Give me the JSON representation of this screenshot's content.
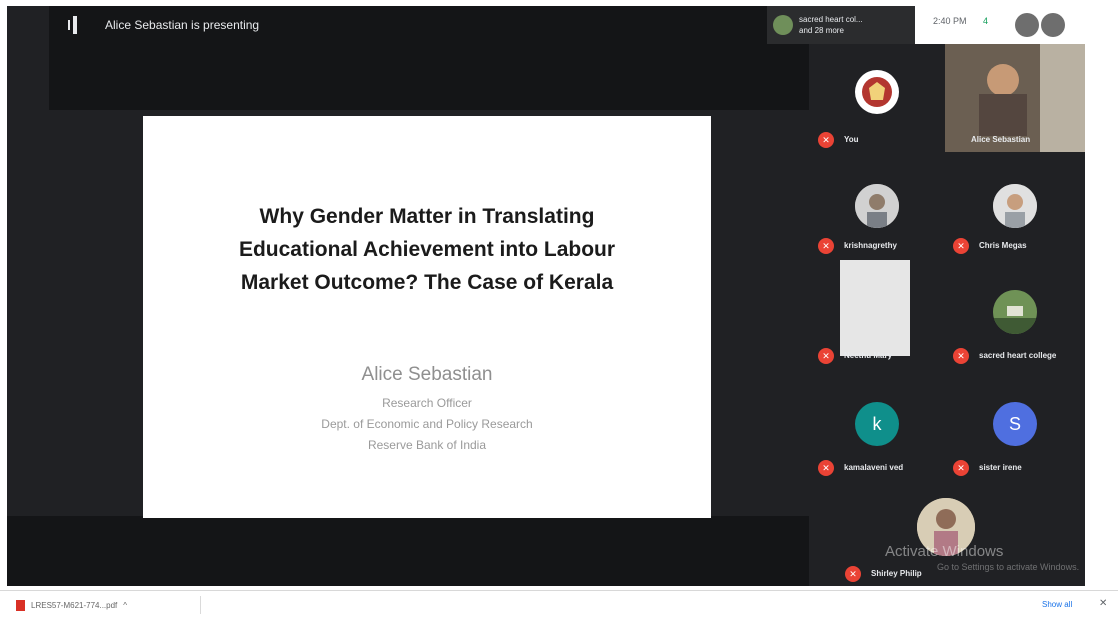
{
  "presenting_banner": {
    "text": "Alice Sebastian is presenting"
  },
  "host_chip": {
    "text_line1": "sacred heart col...",
    "text_line2": "and 28 more"
  },
  "controls": {
    "time_label": "2:40 PM",
    "chat_count": "4"
  },
  "slide": {
    "title_lines": [
      "Why Gender Matter in Translating",
      "Educational Achievement into Labour",
      "Market Outcome? The Case of Kerala"
    ],
    "author": "Alice Sebastian",
    "lines": [
      "Research Officer",
      "Dept. of Economic and Policy Research",
      "Reserve Bank of India"
    ]
  },
  "participants": [
    {
      "name": "You",
      "avatar_letter": "",
      "color": "#ffffff"
    },
    {
      "name": "Alice Sebastian",
      "avatar_letter": "",
      "color": "#6b5f52"
    },
    {
      "name": "krishnagrethy",
      "avatar_letter": "",
      "color": "#c9c9c9"
    },
    {
      "name": "Chris Megas",
      "avatar_letter": "",
      "color": "#c9c9c9"
    },
    {
      "name": "Neethu Mary",
      "avatar_letter": "",
      "color": "#e6e6e6"
    },
    {
      "name": "sacred heart college",
      "avatar_letter": "",
      "color": "#3f5a34"
    },
    {
      "name": "kamalaveni ved",
      "avatar_letter": "k",
      "color": "#0f8f8b"
    },
    {
      "name": "sister irene",
      "avatar_letter": "S",
      "color": "#4f6fe0"
    },
    {
      "name": "Shirley Philip",
      "avatar_letter": "",
      "color": "#d9cbb0"
    }
  ],
  "watermark": {
    "line1": "Activate Windows",
    "line2": "Go to Settings to activate Windows."
  },
  "downloads": {
    "file_name": "LRES57-M621-774...pdf",
    "show_all": "Show all",
    "close": "✕"
  },
  "colors": {
    "meet_bg": "#202124",
    "mic_off": "#ea4335"
  }
}
